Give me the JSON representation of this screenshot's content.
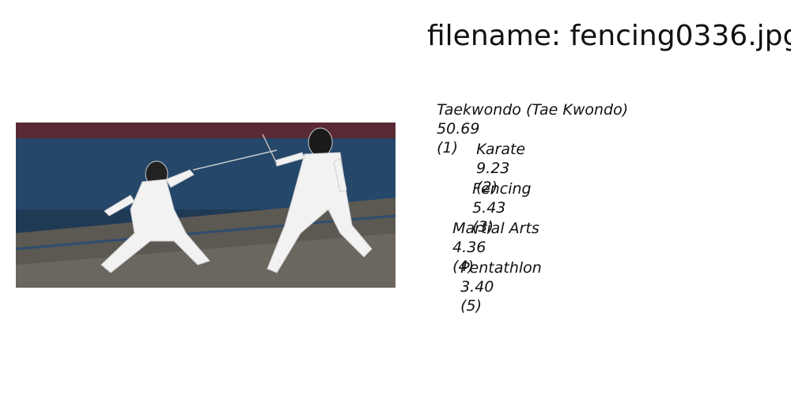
{
  "title": "filename: fencing0336.jpg",
  "image": {
    "subject": "fencing-bout-photo"
  },
  "predictions": [
    {
      "label": "Taekwondo (Tae Kwondo)",
      "score": "50.69",
      "rank": "(1)"
    },
    {
      "label": "Karate",
      "score": "9.23",
      "rank": "(2)"
    },
    {
      "label": "Fencing",
      "score": "5.43",
      "rank": "(3)"
    },
    {
      "label": "Martial Arts",
      "score": "4.36",
      "rank": "(4)"
    },
    {
      "label": "Pentathlon",
      "score": "3.40",
      "rank": "(5)"
    }
  ]
}
